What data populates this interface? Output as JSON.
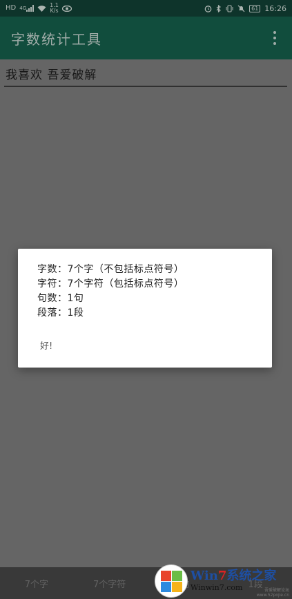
{
  "status_bar": {
    "left_icons": [
      "hd-icon",
      "signal-4g-icon",
      "wifi-icon",
      "eye-icon"
    ],
    "hd": "HD",
    "net_type": "4G",
    "net_speed_value": "1.1",
    "net_speed_unit": "K/s",
    "battery": "61",
    "time": "16:26"
  },
  "app_bar": {
    "title": "字数统计工具"
  },
  "editor": {
    "value": "我喜欢 吾爱破解"
  },
  "bottom_tabs": [
    "7个字",
    "7个字符",
    "1句",
    "1段"
  ],
  "dialog": {
    "lines": [
      "字数：7个字（不包括标点符号）",
      "字符：7个字符（包括标点符号）",
      "句数：1句",
      "段落：1段"
    ],
    "ok_label": "好!"
  },
  "watermark": {
    "brand_prefix": "Win",
    "brand_seven": "7",
    "brand_suffix": "系统之家",
    "url": "Winwin7.com",
    "corner_text": "吾爱破解论坛",
    "corner_url": "www.52pojie.cn"
  }
}
